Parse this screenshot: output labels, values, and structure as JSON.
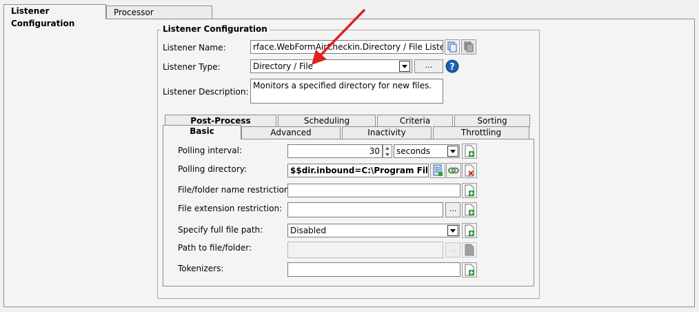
{
  "tabs": {
    "listener": "Listener Configuration",
    "processor": "Processor Configuration"
  },
  "group": {
    "title": "Listener Configuration"
  },
  "form": {
    "name_label": "Listener Name:",
    "name_value": "rface.WebFormAirCheckin.Directory / File Listener",
    "type_label": "Listener Type:",
    "type_value": "Directory / File",
    "type_ellipsis": "...",
    "description_label": "Listener Description:",
    "description_value": "Monitors a specified directory for new files."
  },
  "subtabs": {
    "row_back": [
      "Post-Process",
      "Scheduling",
      "Criteria",
      "Sorting"
    ],
    "row_front": [
      "Basic",
      "Advanced",
      "Inactivity",
      "Throttling"
    ]
  },
  "basic": {
    "polling_interval_label": "Polling interval:",
    "polling_interval_value": "30",
    "polling_interval_unit": "seconds",
    "polling_directory_label": "Polling directory:",
    "polling_directory_value": "$$dir.inbound=C:\\Program Files\\Pilot",
    "name_restriction_label": "File/folder name restriction:",
    "name_restriction_value": "",
    "ext_restriction_label": "File extension restriction:",
    "ext_restriction_value": "",
    "ext_ellipsis": "...",
    "full_path_label": "Specify full file path:",
    "full_path_value": "Disabled",
    "path_label": "Path to file/folder:",
    "path_value": "",
    "path_ellipsis": "...",
    "tokenizers_label": "Tokenizers:",
    "tokenizers_value": ""
  },
  "colors": {
    "arrow": "#e02020",
    "help": "#1a5fb4"
  }
}
